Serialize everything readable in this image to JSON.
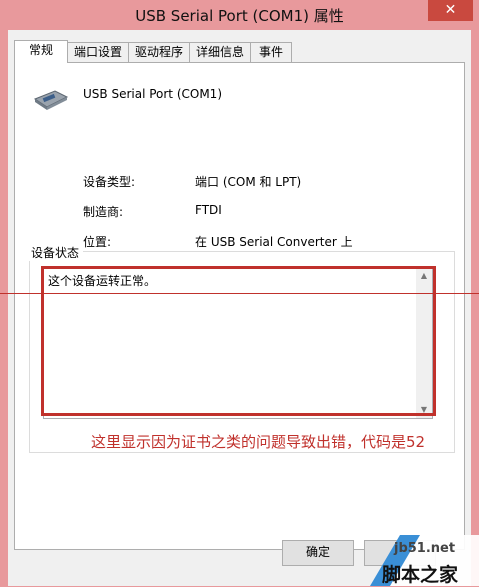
{
  "window": {
    "title": "USB Serial Port (COM1) 属性",
    "close_glyph": "✕"
  },
  "tabs": [
    {
      "label": "常规"
    },
    {
      "label": "端口设置"
    },
    {
      "label": "驱动程序"
    },
    {
      "label": "详细信息"
    },
    {
      "label": "事件"
    }
  ],
  "device": {
    "name": "USB Serial Port (COM1)",
    "icon": "usb-serial-port-icon"
  },
  "properties": [
    {
      "label": "设备类型:",
      "value": "端口 (COM 和 LPT)"
    },
    {
      "label": "制造商:",
      "value": "FTDI"
    },
    {
      "label": "位置:",
      "value": "在 USB Serial Converter 上"
    }
  ],
  "status_group": {
    "label": "设备状态",
    "text": "这个设备运转正常。"
  },
  "annotation": "这里显示因为证书之类的问题导致出错，代码是52",
  "buttons": {
    "ok": "确定"
  },
  "watermark": {
    "site": "jb51.net",
    "brand": "脚本之家"
  },
  "colors": {
    "annotation_red": "#c0312c",
    "titlebar": "#e8999c"
  }
}
